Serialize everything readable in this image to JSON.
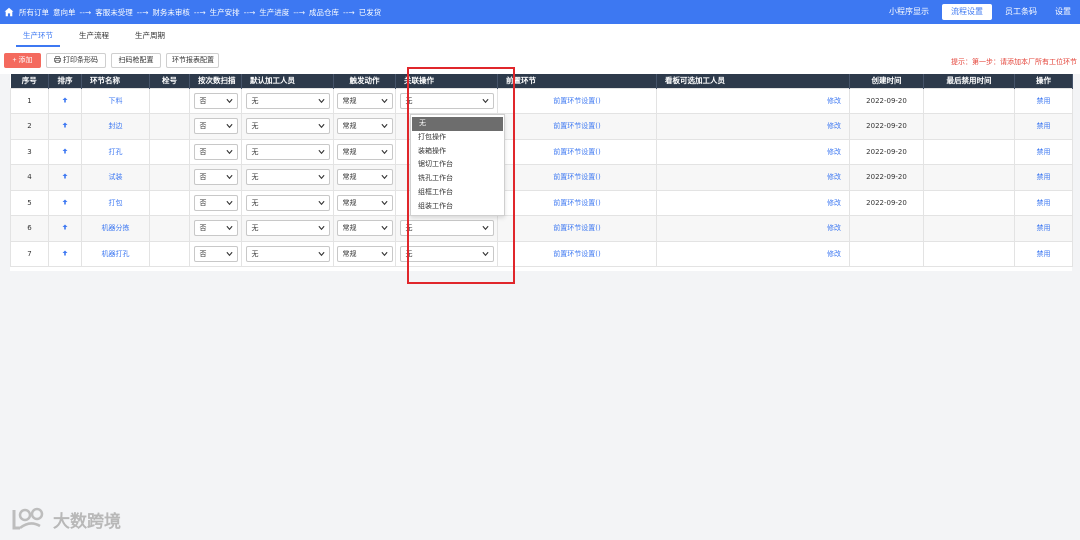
{
  "topbar": {
    "crumbs": [
      "所有订单",
      "意向单",
      "客服未受理",
      "财务未审核",
      "生产安排",
      "生产进度",
      "成品仓库",
      "已发货"
    ],
    "separator": "--→",
    "nav": [
      "小程序显示",
      "流程设置",
      "员工条码",
      "设置"
    ],
    "active_nav": "流程设置"
  },
  "subtabs": [
    "生产环节",
    "生产流程",
    "生产周期"
  ],
  "toolbar": {
    "add": "+ 添加",
    "print": "打印条形码",
    "scan_config": "扫码枪配置",
    "report_config": "环节报表配置",
    "hint": "提示：第一步：请添加本厂所有工位环节"
  },
  "table": {
    "headers": [
      "序号",
      "排序",
      "环节名称",
      "栓号",
      "按次数扫描",
      "默认加工人员",
      "触发动作",
      "关联操作",
      "前置环节",
      "看板可选加工人员",
      "创建时间",
      "最后禁用时间",
      "操作"
    ],
    "rows": [
      {
        "no": "1",
        "name": "下料",
        "scan": "否",
        "worker": "无",
        "trigger": "常规",
        "assoc": "无",
        "pre": "前置环节设置()",
        "edit": "修改",
        "created": "2022-09-20",
        "action": "禁用"
      },
      {
        "no": "2",
        "name": "封边",
        "scan": "否",
        "worker": "无",
        "trigger": "常规",
        "assoc": "",
        "pre": "前置环节设置()",
        "edit": "修改",
        "created": "2022-09-20",
        "action": "禁用"
      },
      {
        "no": "3",
        "name": "打孔",
        "scan": "否",
        "worker": "无",
        "trigger": "常规",
        "assoc": "",
        "pre": "前置环节设置()",
        "edit": "修改",
        "created": "2022-09-20",
        "action": "禁用"
      },
      {
        "no": "4",
        "name": "试装",
        "scan": "否",
        "worker": "无",
        "trigger": "常规",
        "assoc": "",
        "pre": "前置环节设置()",
        "edit": "修改",
        "created": "2022-09-20",
        "action": "禁用"
      },
      {
        "no": "5",
        "name": "打包",
        "scan": "否",
        "worker": "无",
        "trigger": "常规",
        "assoc": "",
        "pre": "前置环节设置()",
        "edit": "修改",
        "created": "2022-09-20",
        "action": "禁用"
      },
      {
        "no": "6",
        "name": "机器分拣",
        "scan": "否",
        "worker": "无",
        "trigger": "常规",
        "assoc": "无",
        "pre": "前置环节设置()",
        "edit": "修改",
        "created": "",
        "action": "禁用"
      },
      {
        "no": "7",
        "name": "机器打孔",
        "scan": "否",
        "worker": "无",
        "trigger": "常规",
        "assoc": "无",
        "pre": "前置环节设置()",
        "edit": "修改",
        "created": "",
        "action": "禁用"
      }
    ]
  },
  "dropdown": {
    "options": [
      "无",
      "打包操作",
      "装箱操作",
      "锯切工作台",
      "铣孔工作台",
      "组框工作台",
      "组装工作台"
    ],
    "selected": "无"
  },
  "watermark": {
    "text": "大数跨境"
  },
  "colors": {
    "primary": "#3d78f2",
    "header_bg": "#2d3a4b",
    "add_button": "#f46a5e",
    "hint_red": "#e4443a",
    "highlight_red": "#e0262b"
  }
}
